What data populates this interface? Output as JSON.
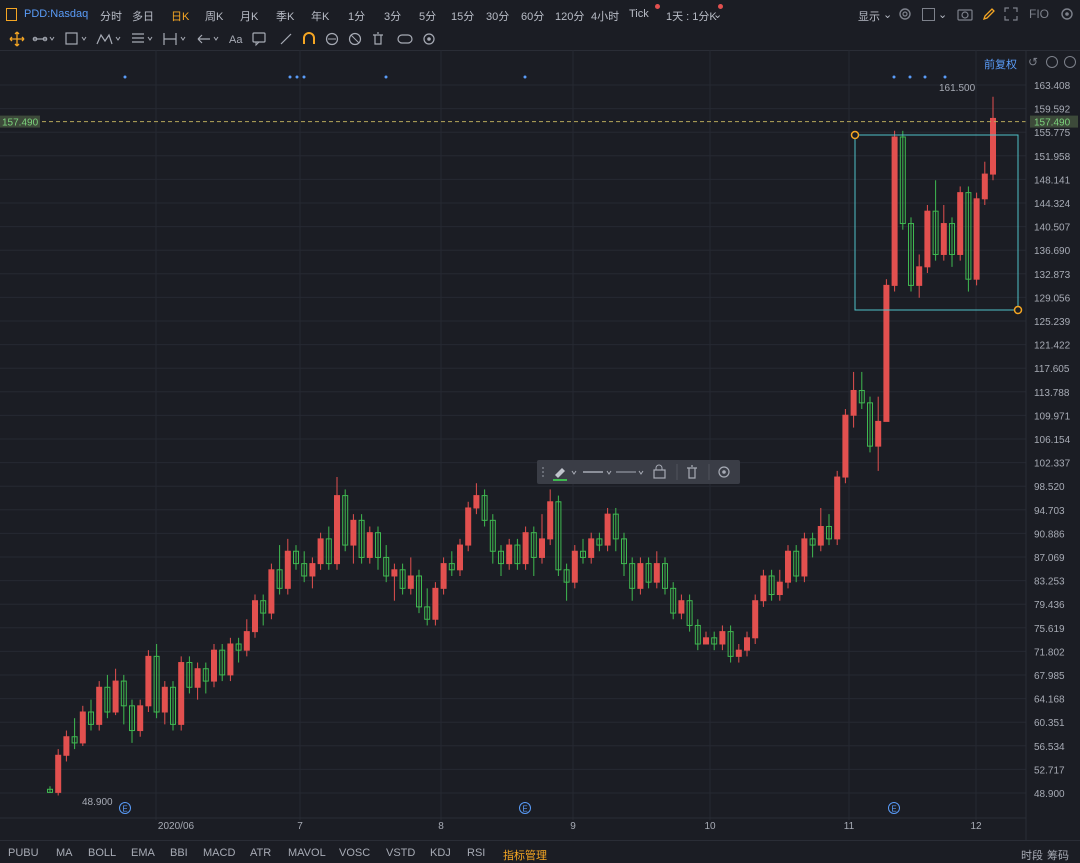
{
  "header": {
    "symbol": "PDD:Nasdaq",
    "timeframes": [
      "分时",
      "多日",
      "日K",
      "周K",
      "月K",
      "季K",
      "年K",
      "1分",
      "3分",
      "5分",
      "15分",
      "30分",
      "60分",
      "120分",
      "4小时",
      "Tick",
      "1天 : 1分K"
    ],
    "active_timeframe": "日K",
    "display_label": "显示",
    "fio_label": "FIO"
  },
  "adjust_label": "前复权",
  "price_axis": [
    "163.408",
    "159.592",
    "155.775",
    "151.958",
    "148.141",
    "144.324",
    "140.507",
    "136.690",
    "132.873",
    "129.056",
    "125.239",
    "121.422",
    "117.605",
    "113.788",
    "109.971",
    "106.154",
    "102.337",
    "98.520",
    "94.703",
    "90.886",
    "87.069",
    "83.253",
    "79.436",
    "75.619",
    "71.802",
    "67.985",
    "64.168",
    "60.351",
    "56.534",
    "52.717",
    "48.900"
  ],
  "current_price": "157.490",
  "high_marker": "161.500",
  "low_marker": "48.900",
  "x_axis": [
    {
      "label": "2020/06",
      "x": 176
    },
    {
      "label": "7",
      "x": 300
    },
    {
      "label": "8",
      "x": 441
    },
    {
      "label": "9",
      "x": 573
    },
    {
      "label": "10",
      "x": 710
    },
    {
      "label": "11",
      "x": 849
    },
    {
      "label": "12",
      "x": 976
    }
  ],
  "earnings_marker": "E",
  "indicators": [
    "PUBU",
    "MA",
    "BOLL",
    "EMA",
    "BBI",
    "MACD",
    "ATR",
    "MAVOL",
    "VOSC",
    "VSTD",
    "KDJ",
    "RSI",
    "指标管理"
  ],
  "active_indicator": "指标管理",
  "right_tabs": [
    "时段",
    "筹码"
  ],
  "colors": {
    "up": "#e2504f",
    "down": "#3fb950",
    "bg": "#1b1d24",
    "accent": "#f5a623",
    "box": "#4fc1c7",
    "grid": "#262932"
  },
  "chart_data": {
    "type": "candlestick",
    "ylim": [
      48.9,
      163.408
    ],
    "candles": [
      [
        49.5,
        49,
        50,
        48.9
      ],
      [
        49,
        55,
        56,
        48.5
      ],
      [
        55,
        58,
        59,
        54
      ],
      [
        58,
        57,
        61,
        56
      ],
      [
        57,
        62,
        63,
        56.5
      ],
      [
        62,
        60,
        64,
        59
      ],
      [
        60,
        66,
        67,
        59
      ],
      [
        66,
        62,
        68,
        61
      ],
      [
        62,
        67,
        69,
        61.5
      ],
      [
        67,
        63,
        68,
        60
      ],
      [
        63,
        59,
        64,
        57
      ],
      [
        59,
        63,
        64,
        58
      ],
      [
        63,
        71,
        72,
        62
      ],
      [
        71,
        62,
        73,
        61
      ],
      [
        62,
        66,
        67,
        60
      ],
      [
        66,
        60,
        67,
        59
      ],
      [
        60,
        70,
        71,
        59
      ],
      [
        70,
        66,
        71,
        65
      ],
      [
        66,
        69,
        70,
        64
      ],
      [
        69,
        67,
        70,
        65
      ],
      [
        67,
        72,
        73,
        66
      ],
      [
        72,
        68,
        73,
        67
      ],
      [
        68,
        73,
        74,
        67
      ],
      [
        73,
        72,
        74,
        70
      ],
      [
        72,
        75,
        77,
        71
      ],
      [
        75,
        80,
        81,
        74
      ],
      [
        80,
        78,
        81,
        76
      ],
      [
        78,
        85,
        86,
        77
      ],
      [
        85,
        82,
        89,
        81
      ],
      [
        82,
        88,
        90,
        81
      ],
      [
        88,
        86,
        89,
        85
      ],
      [
        86,
        84,
        88,
        83
      ],
      [
        84,
        86,
        87,
        82
      ],
      [
        86,
        90,
        91,
        85
      ],
      [
        90,
        86,
        92,
        85
      ],
      [
        86,
        97,
        100,
        85
      ],
      [
        97,
        89,
        98,
        88
      ],
      [
        89,
        93,
        94,
        86
      ],
      [
        93,
        87,
        94,
        86
      ],
      [
        87,
        91,
        92,
        86
      ],
      [
        91,
        87,
        92,
        85
      ],
      [
        87,
        84,
        89,
        83
      ],
      [
        84,
        85,
        86,
        80
      ],
      [
        85,
        82,
        86,
        81
      ],
      [
        82,
        84,
        87,
        81
      ],
      [
        84,
        79,
        85,
        78
      ],
      [
        79,
        77,
        82,
        76
      ],
      [
        77,
        82,
        83,
        76
      ],
      [
        82,
        86,
        87,
        81
      ],
      [
        86,
        85,
        88,
        84
      ],
      [
        85,
        89,
        90,
        84
      ],
      [
        89,
        95,
        96,
        88
      ],
      [
        95,
        97,
        99,
        94
      ],
      [
        97,
        93,
        98,
        92
      ],
      [
        93,
        88,
        94,
        86
      ],
      [
        88,
        86,
        89,
        84
      ],
      [
        86,
        89,
        90,
        85
      ],
      [
        89,
        86,
        90,
        85
      ],
      [
        86,
        91,
        92,
        85
      ],
      [
        91,
        87,
        92,
        84
      ],
      [
        87,
        90,
        94,
        86
      ],
      [
        90,
        96,
        98,
        89
      ],
      [
        96,
        85,
        97,
        84
      ],
      [
        85,
        83,
        86,
        80
      ],
      [
        83,
        88,
        89,
        82
      ],
      [
        88,
        87,
        90,
        86
      ],
      [
        87,
        90,
        91,
        86
      ],
      [
        90,
        89,
        91,
        88
      ],
      [
        89,
        94,
        95,
        88
      ],
      [
        94,
        90,
        95,
        88
      ],
      [
        90,
        86,
        91,
        84
      ],
      [
        86,
        82,
        87,
        80
      ],
      [
        82,
        86,
        87,
        81
      ],
      [
        86,
        83,
        87,
        82
      ],
      [
        83,
        86,
        88,
        82
      ],
      [
        86,
        82,
        87,
        81
      ],
      [
        82,
        78,
        83,
        77
      ],
      [
        78,
        80,
        81,
        77
      ],
      [
        80,
        76,
        81,
        75
      ],
      [
        76,
        73,
        77,
        72
      ],
      [
        73,
        74,
        75,
        73
      ],
      [
        74,
        73,
        75,
        72
      ],
      [
        73,
        75,
        76,
        72
      ],
      [
        75,
        71,
        76,
        70
      ],
      [
        71,
        72,
        73,
        70
      ],
      [
        72,
        74,
        75,
        71
      ],
      [
        74,
        80,
        81,
        73
      ],
      [
        80,
        84,
        85,
        79
      ],
      [
        84,
        81,
        85,
        80
      ],
      [
        81,
        83,
        85,
        80
      ],
      [
        83,
        88,
        89,
        82
      ],
      [
        88,
        84,
        89,
        83
      ],
      [
        84,
        90,
        91,
        83
      ],
      [
        90,
        89,
        91,
        87
      ],
      [
        89,
        92,
        95,
        88
      ],
      [
        92,
        90,
        94,
        89
      ],
      [
        90,
        100,
        101,
        89
      ],
      [
        100,
        110,
        111,
        99
      ],
      [
        110,
        114,
        117,
        108
      ],
      [
        114,
        112,
        117,
        111
      ],
      [
        112,
        105,
        113,
        104
      ],
      [
        105,
        109,
        113,
        101
      ],
      [
        109,
        131,
        132,
        127
      ],
      [
        131,
        155,
        156,
        130
      ],
      [
        155,
        141,
        156,
        140
      ],
      [
        141,
        131,
        142,
        130
      ],
      [
        131,
        134,
        136,
        129
      ],
      [
        134,
        143,
        144,
        133
      ],
      [
        143,
        136,
        148,
        135
      ],
      [
        136,
        141,
        144,
        135
      ],
      [
        141,
        136,
        142,
        134
      ],
      [
        136,
        146,
        147,
        135
      ],
      [
        146,
        132,
        147,
        130
      ],
      [
        132,
        145,
        146,
        131
      ],
      [
        145,
        149,
        151,
        144
      ],
      [
        149,
        158,
        161.5,
        148
      ]
    ]
  }
}
